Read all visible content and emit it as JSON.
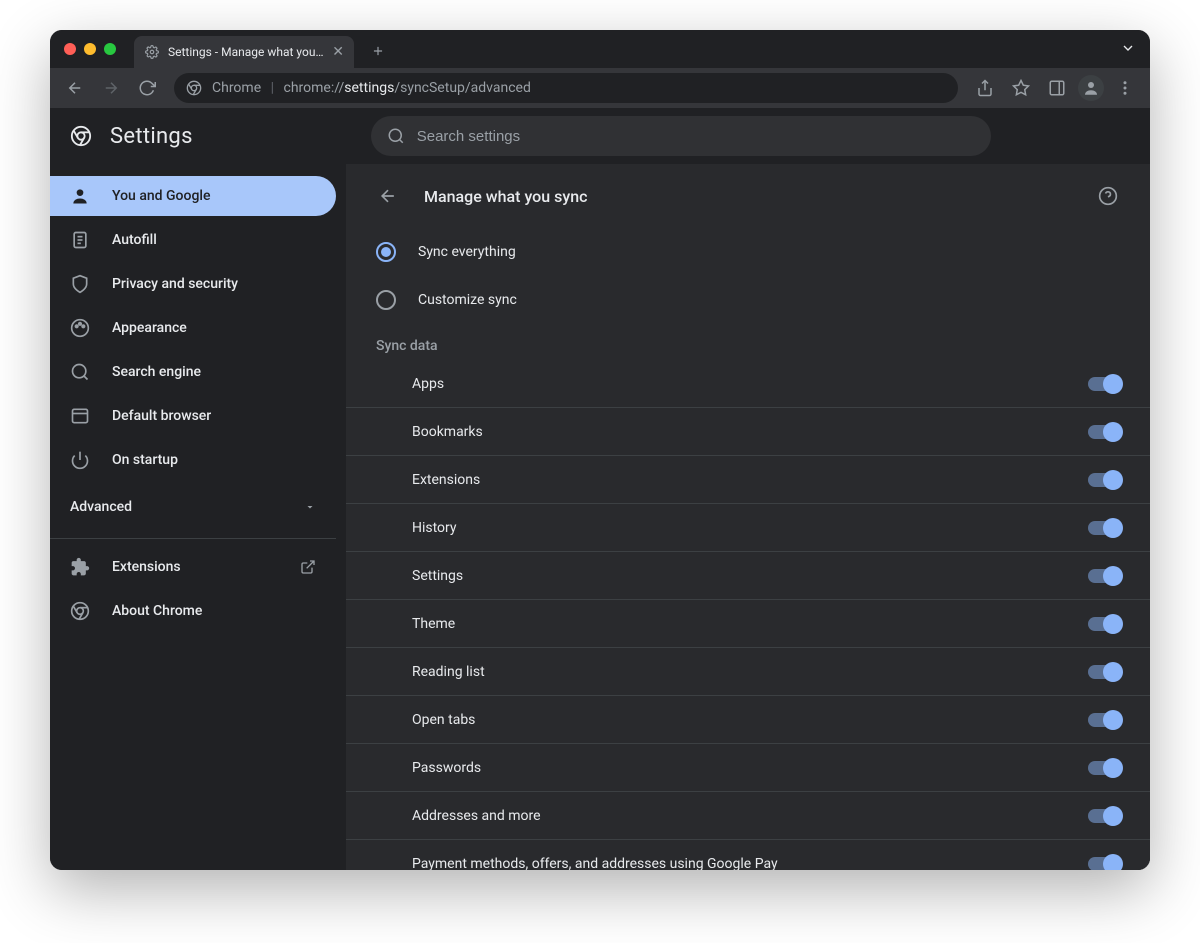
{
  "tab": {
    "title": "Settings - Manage what you sy"
  },
  "omnibox": {
    "prefix": "Chrome",
    "url_dim1": "chrome://",
    "url_bold": "settings",
    "url_dim2": "/syncSetup/advanced"
  },
  "app": {
    "title": "Settings",
    "search_placeholder": "Search settings"
  },
  "sidebar": {
    "items": [
      {
        "label": "You and Google",
        "active": true
      },
      {
        "label": "Autofill"
      },
      {
        "label": "Privacy and security"
      },
      {
        "label": "Appearance"
      },
      {
        "label": "Search engine"
      },
      {
        "label": "Default browser"
      },
      {
        "label": "On startup"
      }
    ],
    "advanced_label": "Advanced",
    "extensions_label": "Extensions",
    "about_label": "About Chrome"
  },
  "panel": {
    "title": "Manage what you sync",
    "radio_all": "Sync everything",
    "radio_custom": "Customize sync",
    "group_title": "Sync data",
    "sync_items": [
      "Apps",
      "Bookmarks",
      "Extensions",
      "History",
      "Settings",
      "Theme",
      "Reading list",
      "Open tabs",
      "Passwords",
      "Addresses and more",
      "Payment methods, offers, and addresses using Google Pay"
    ]
  }
}
